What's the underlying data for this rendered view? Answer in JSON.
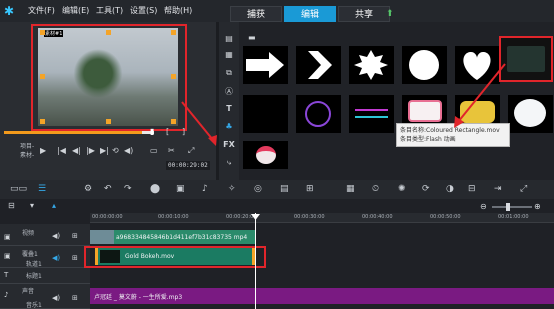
{
  "menu": [
    "文件(F)",
    "编辑(E)",
    "工具(T)",
    "设置(S)",
    "帮助(H)"
  ],
  "tabs": [
    {
      "label": "捕获",
      "active": false
    },
    {
      "label": "编辑",
      "active": true
    },
    {
      "label": "共享",
      "active": false
    }
  ],
  "preview": {
    "badge": "素材#1"
  },
  "player": {
    "project_label": "项目-",
    "clip_label": "素材-",
    "timecode": "00:00:29:02"
  },
  "library": {
    "tooltip_name": "条目名称:Coloured Rectangle.mov",
    "tooltip_type": "条目类型:Flash 动画",
    "fx_label": "FX",
    "icons": [
      "media-icon",
      "instant-project-icon",
      "transition-icon",
      "title-icon",
      "text-icon",
      "graphic-icon",
      "fx-icon",
      "path-icon"
    ]
  },
  "ruler": [
    "00:00:00:00",
    "00:00:10:00",
    "00:00:20:00",
    "00:00:30:00",
    "00:00:40:00",
    "00:00:50:00",
    "00:01:00:00"
  ],
  "tracks": {
    "video": {
      "label": "视频",
      "clip": "a968334845846b1d411ef7b31c83735 mp4"
    },
    "overlay": {
      "label": "轨道1",
      "sub": "覆叠1",
      "clip": "Gold Bokeh.mov"
    },
    "title": {
      "label": "标题1"
    },
    "audio": {
      "label": "声音",
      "sub": "音乐1",
      "clip": "卢冠廷 _ 莫文蔚 - 一生所爱.mp3"
    }
  }
}
